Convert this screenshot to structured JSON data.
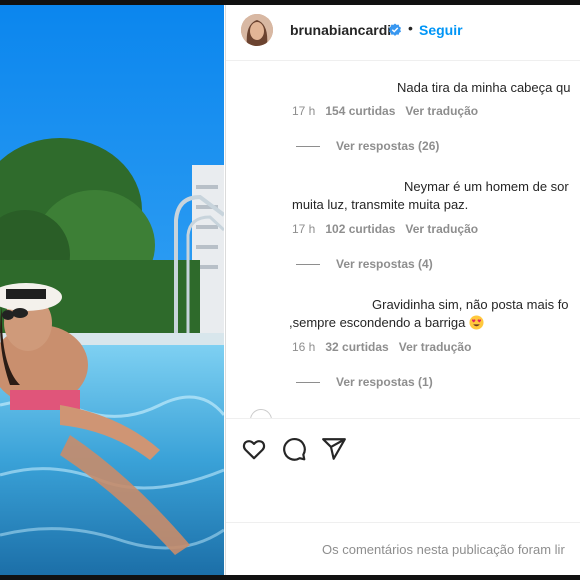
{
  "post": {
    "username": "brunabiancardi",
    "verified_icon": "verified-badge-icon",
    "separator": "•",
    "follow_label": "Seguir"
  },
  "comments": [
    {
      "text_lines": [
        "Nada tira da minha cabeça qu"
      ],
      "time": "17 h",
      "likes": "154 curtidas",
      "translate": "Ver tradução",
      "replies": "Ver respostas (26)"
    },
    {
      "text_lines": [
        "Neymar é um homem de sor",
        "muita luz, transmite muita paz."
      ],
      "time": "17 h",
      "likes": "102 curtidas",
      "translate": "Ver tradução",
      "replies": "Ver respostas (4)"
    },
    {
      "text_lines": [
        "Gravidinha sim, não posta mais fo",
        ",sempre escondendo a barriga"
      ],
      "emoji": "smiling-face-with-heart-eyes",
      "time": "16 h",
      "likes": "32 curtidas",
      "translate": "Ver tradução",
      "replies": "Ver respostas (1)"
    }
  ],
  "actions": {
    "like_icon": "heart-icon",
    "comment_icon": "comment-icon",
    "share_icon": "share-icon"
  },
  "footer": {
    "comments_limited": "Os comentários nesta publicação foram lir"
  },
  "colors": {
    "link_blue": "#0095f6",
    "muted_text": "#8e8e8e",
    "text": "#262626",
    "sky": "#1e8ff0"
  }
}
